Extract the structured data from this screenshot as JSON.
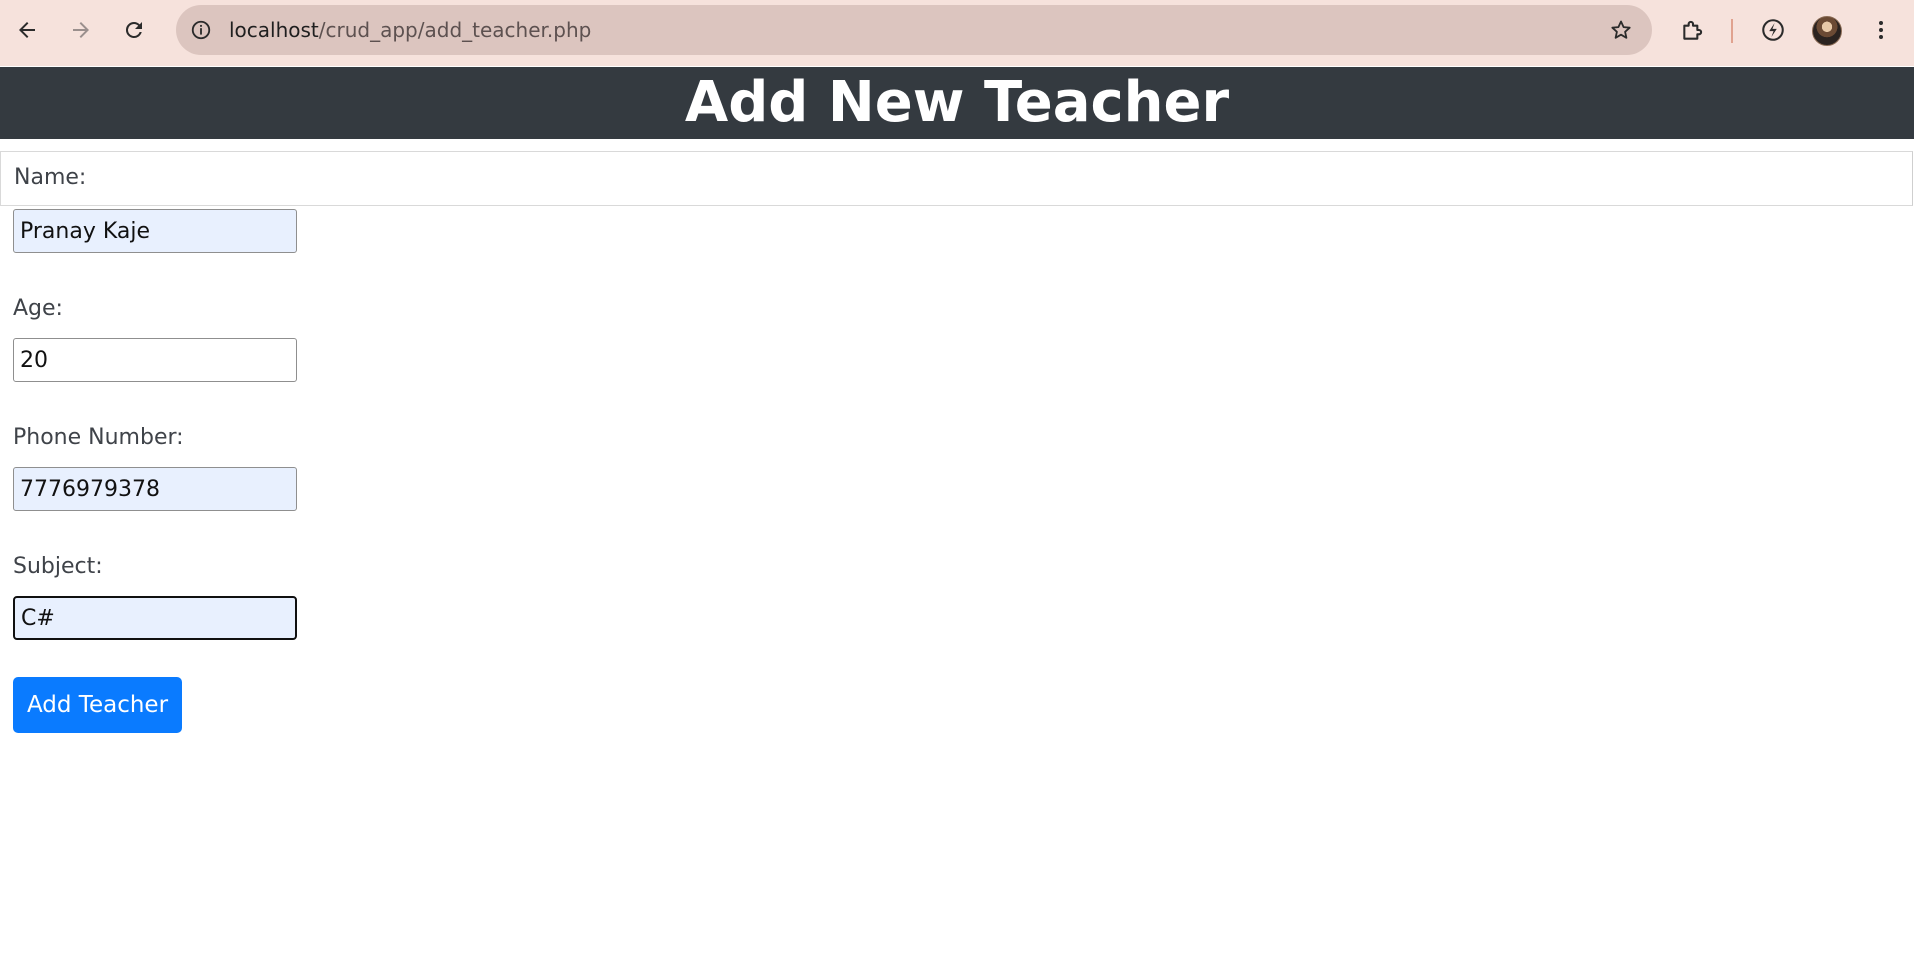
{
  "browser": {
    "url_host": "localhost",
    "url_path": "/crud_app/add_teacher.php",
    "icons": {
      "back": "arrow-left-icon",
      "forward": "arrow-right-icon",
      "reload": "reload-icon",
      "site_info": "info-icon",
      "bookmark": "star-icon",
      "extensions": "puzzle-icon",
      "performance": "leaf-icon",
      "profile": "avatar",
      "menu": "kebab-menu-icon"
    }
  },
  "page": {
    "title": "Add New Teacher",
    "colors": {
      "header_bg": "#343a40",
      "button_bg": "#0a7bff",
      "autofill_bg": "#e8f0fe"
    }
  },
  "form": {
    "name_label": "Name:",
    "name_value": "Pranay Kaje",
    "age_label": "Age:",
    "age_value": "20",
    "phone_label": "Phone Number:",
    "phone_value": "7776979378",
    "subject_label": "Subject:",
    "subject_value": "C#",
    "submit_label": "Add Teacher"
  }
}
